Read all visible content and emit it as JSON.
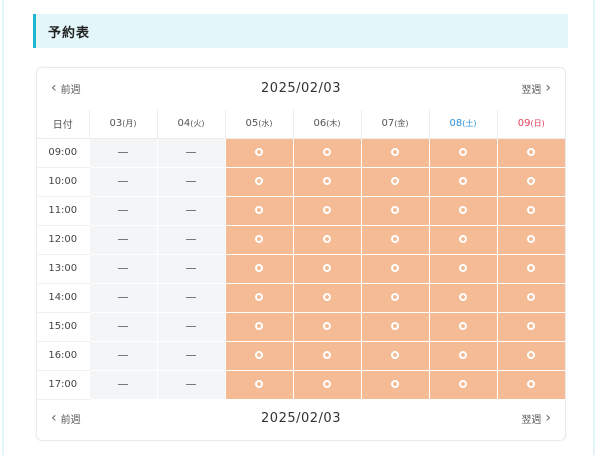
{
  "section": {
    "title": "予約表"
  },
  "calendar": {
    "prev_label": "前週",
    "next_label": "翌週",
    "current_date": "2025/02/03",
    "corner_label": "日付",
    "days": [
      {
        "date": "03",
        "dow": "(月)",
        "type": "weekday"
      },
      {
        "date": "04",
        "dow": "(火)",
        "type": "weekday"
      },
      {
        "date": "05",
        "dow": "(水)",
        "type": "weekday"
      },
      {
        "date": "06",
        "dow": "(木)",
        "type": "weekday"
      },
      {
        "date": "07",
        "dow": "(金)",
        "type": "weekday"
      },
      {
        "date": "08",
        "dow": "(土)",
        "type": "sat"
      },
      {
        "date": "09",
        "dow": "(日)",
        "type": "sun"
      }
    ],
    "times": [
      "09:00",
      "10:00",
      "11:00",
      "12:00",
      "13:00",
      "14:00",
      "15:00",
      "16:00",
      "17:00"
    ],
    "availability": [
      "unavailable",
      "unavailable",
      "available",
      "available",
      "available",
      "available",
      "available"
    ],
    "unavailable_mark": "—",
    "available_mark": "◯",
    "colors": {
      "accent": "#1fb7cf",
      "available_bg": "#f4bb94",
      "unavailable_bg": "#f4f5f7",
      "saturday": "#2d8fd6",
      "sunday": "#e0405a"
    }
  }
}
